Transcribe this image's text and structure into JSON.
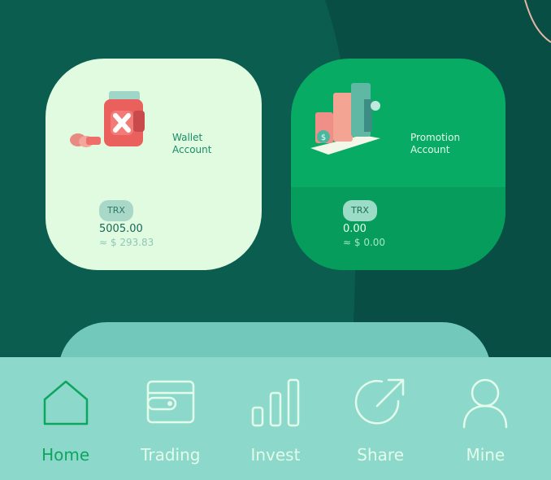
{
  "cards": {
    "wallet": {
      "label_line1": "Wallet",
      "label_line2": "Account",
      "currency": "TRX",
      "amount": "5005.00",
      "usd": "≈ $ 293.83"
    },
    "promotion": {
      "label_line1": "Promotion",
      "label_line2": "Account",
      "currency": "TRX",
      "amount": "0.00",
      "usd": "≈ $ 0.00"
    }
  },
  "nav": {
    "active": "home",
    "items": [
      {
        "id": "home",
        "label": "Home",
        "icon": "home-icon"
      },
      {
        "id": "trading",
        "label": "Trading",
        "icon": "wallet-icon"
      },
      {
        "id": "invest",
        "label": "Invest",
        "icon": "bar-chart-icon"
      },
      {
        "id": "share",
        "label": "Share",
        "icon": "share-arrow-icon"
      },
      {
        "id": "mine",
        "label": "Mine",
        "icon": "user-icon"
      }
    ]
  },
  "colors": {
    "background": "#0c5a4c",
    "wallet_card": "#e1fbe1",
    "promo_card": "#07ab63",
    "navbar": "#8cd9cb",
    "nav_active": "#0ea55f",
    "nav_inactive": "#e3fbea"
  }
}
